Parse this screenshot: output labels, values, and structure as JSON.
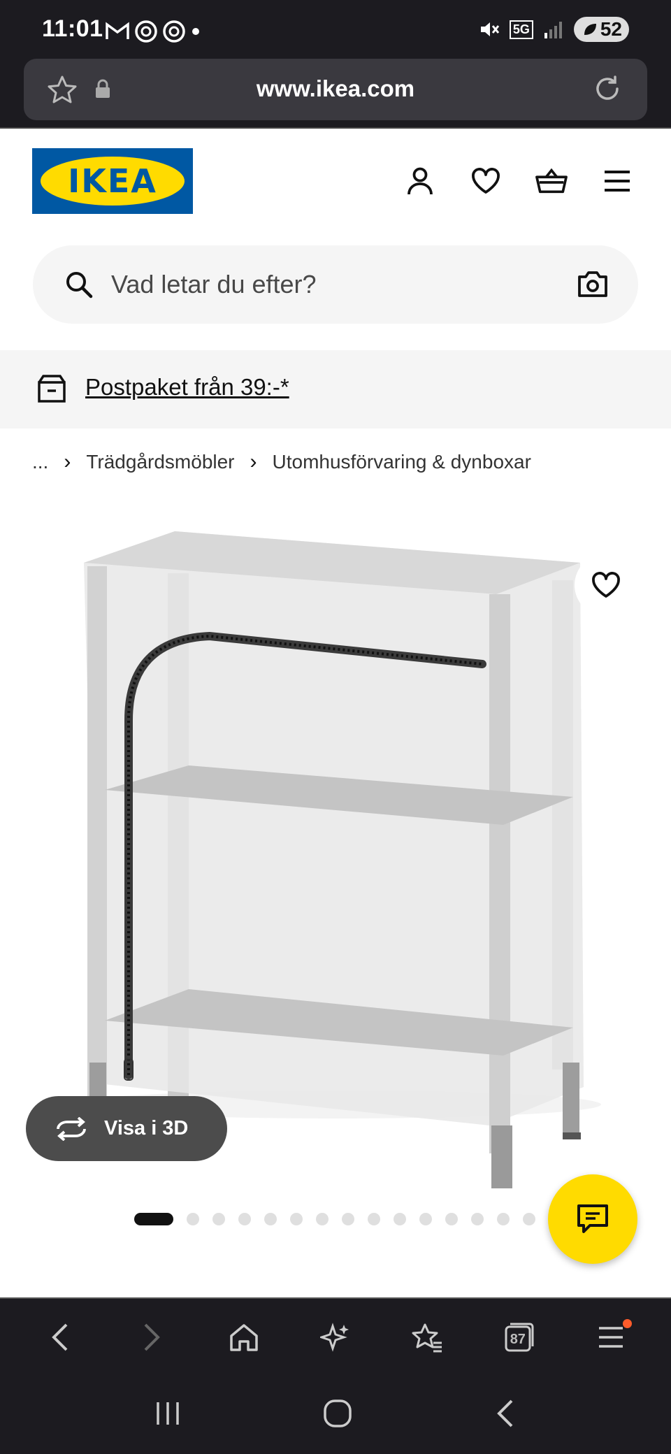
{
  "status_bar": {
    "time": "11:01",
    "network": "5G",
    "battery": "52"
  },
  "browser": {
    "url": "www.ikea.com",
    "tab_count": "87"
  },
  "header": {
    "logo_text": "IKEA",
    "brand_colors": {
      "blue": "#0058a3",
      "yellow": "#ffdb00"
    }
  },
  "search": {
    "placeholder": "Vad letar du efter?"
  },
  "promo": {
    "text": "Postpaket från 39:-*"
  },
  "breadcrumb": {
    "items": [
      "...",
      "Trädgårdsmöbler",
      "Utomhusförvaring & dynboxar"
    ]
  },
  "product": {
    "view3d_label": "Visa i 3D",
    "image_count": 16,
    "active_image": 1
  }
}
